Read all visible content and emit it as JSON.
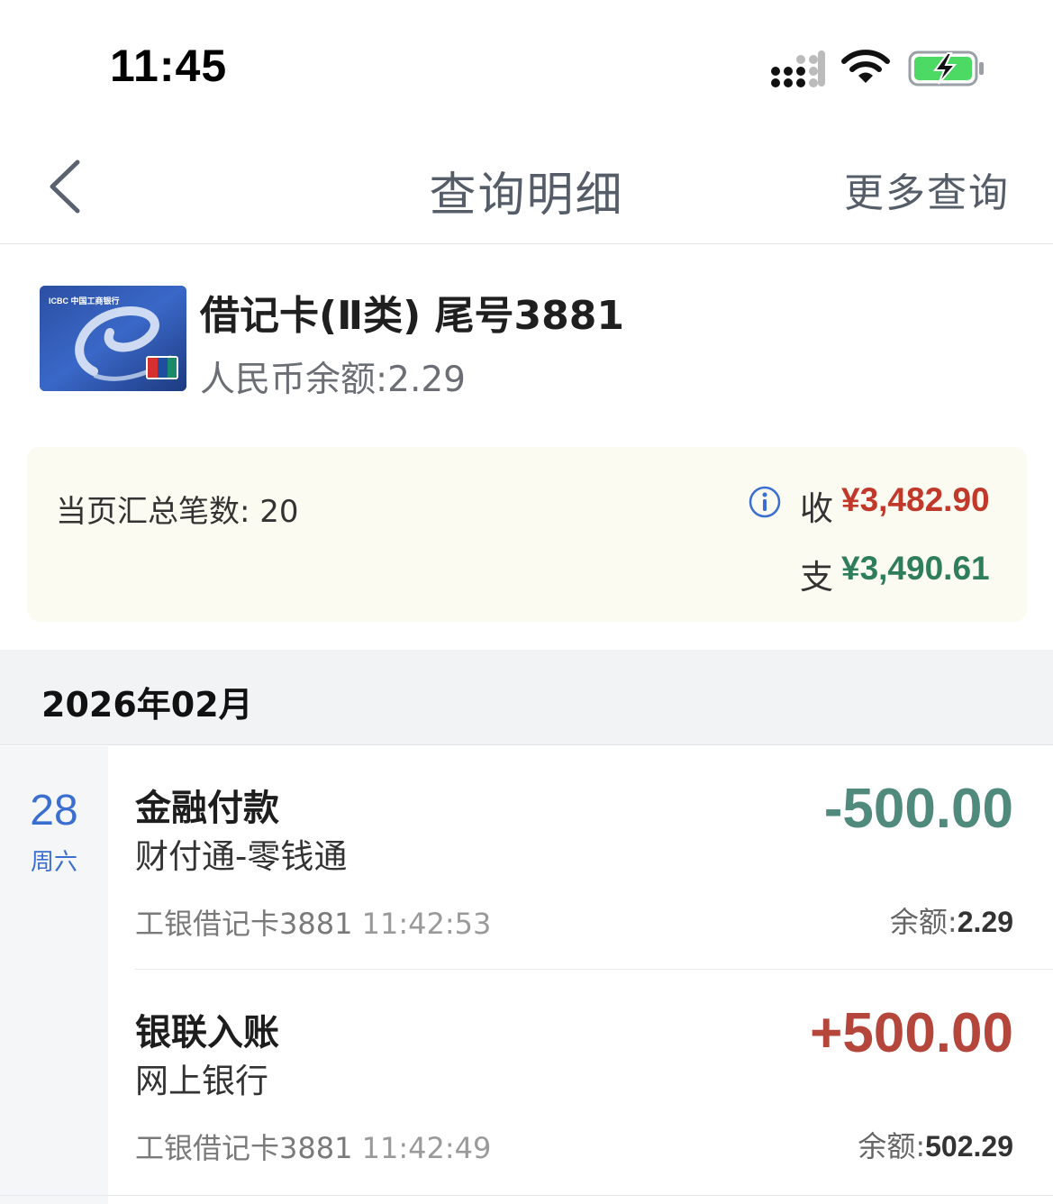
{
  "status_bar": {
    "time": "11:45",
    "signal_icon": "signal-icon",
    "wifi_icon": "wifi-icon",
    "battery_icon": "battery-charging-icon"
  },
  "nav": {
    "title": "查询明细",
    "more": "更多查询",
    "back_icon": "chevron-left-icon"
  },
  "card": {
    "title": "借记卡(Ⅱ类) 尾号3881",
    "balance": "人民币余额:2.29",
    "logo_text": "ICBC 中国工商银行"
  },
  "summary": {
    "count": "当页汇总笔数: 20",
    "income_label": "收",
    "income_value": "¥3,482.90",
    "expense_label": "支",
    "expense_value": "¥3,490.61"
  },
  "month": "2026年02月",
  "date": {
    "day": "28",
    "weekday": "周六"
  },
  "transactions": [
    {
      "title": "金融付款",
      "subtitle": "财付通-零钱通",
      "account": "工银借记卡3881",
      "time": "11:42:53",
      "amount": "-500.00",
      "balance_label": "余额:",
      "balance_value": "2.29"
    },
    {
      "title": "银联入账",
      "subtitle": "网上银行",
      "account": "工银借记卡3881",
      "time": "11:42:49",
      "amount": "+500.00",
      "balance_label": "余额:",
      "balance_value": "502.29"
    }
  ],
  "colors": {
    "income": "#c0392b",
    "expense": "#2e7d5b",
    "date_blue": "#3a6fd1",
    "nav_text": "#555d68",
    "summary_bg": "#fcfbf1"
  }
}
